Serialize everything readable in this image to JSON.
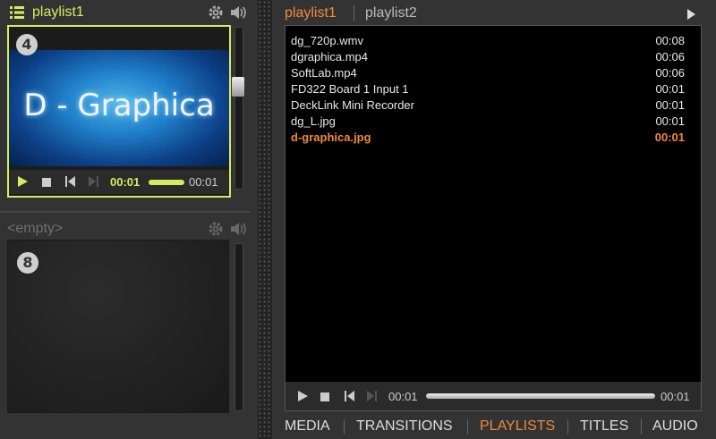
{
  "left_panel": {
    "top_slot": {
      "playlist_name": "playlist1",
      "channel_number": "4",
      "preview_text": "D - Graphica",
      "time_elapsed": "00:01",
      "time_total": "00:01",
      "progress": 1.0,
      "volume": 0.65,
      "accent_color": "#d6ec5f"
    },
    "bottom_slot": {
      "playlist_name": "<empty>",
      "channel_number": "8"
    }
  },
  "right_panel": {
    "tabs": [
      {
        "label": "playlist1",
        "active": true
      },
      {
        "label": "playlist2",
        "active": false
      }
    ],
    "items": [
      {
        "name": "dg_720p.wmv",
        "duration": "00:08",
        "selected": false
      },
      {
        "name": "dgraphica.mp4",
        "duration": "00:06",
        "selected": false
      },
      {
        "name": "SoftLab.mp4",
        "duration": "00:06",
        "selected": false
      },
      {
        "name": "FD322 Board 1 Input 1",
        "duration": "00:01",
        "selected": false
      },
      {
        "name": "DeckLink Mini Recorder",
        "duration": "00:01",
        "selected": false
      },
      {
        "name": "dg_L.jpg",
        "duration": "00:01",
        "selected": false
      },
      {
        "name": "d-graphica.jpg",
        "duration": "00:01",
        "selected": true
      }
    ],
    "transport": {
      "time_elapsed": "00:01",
      "time_total": "00:01",
      "progress": 1.0
    },
    "highlight_color": "#f08a3c"
  },
  "bottom_nav": [
    {
      "label": "MEDIA",
      "active": false
    },
    {
      "label": "TRANSITIONS",
      "active": false
    },
    {
      "label": "PLAYLISTS",
      "active": true
    },
    {
      "label": "TITLES",
      "active": false
    },
    {
      "label": "AUDIO",
      "active": false
    }
  ]
}
